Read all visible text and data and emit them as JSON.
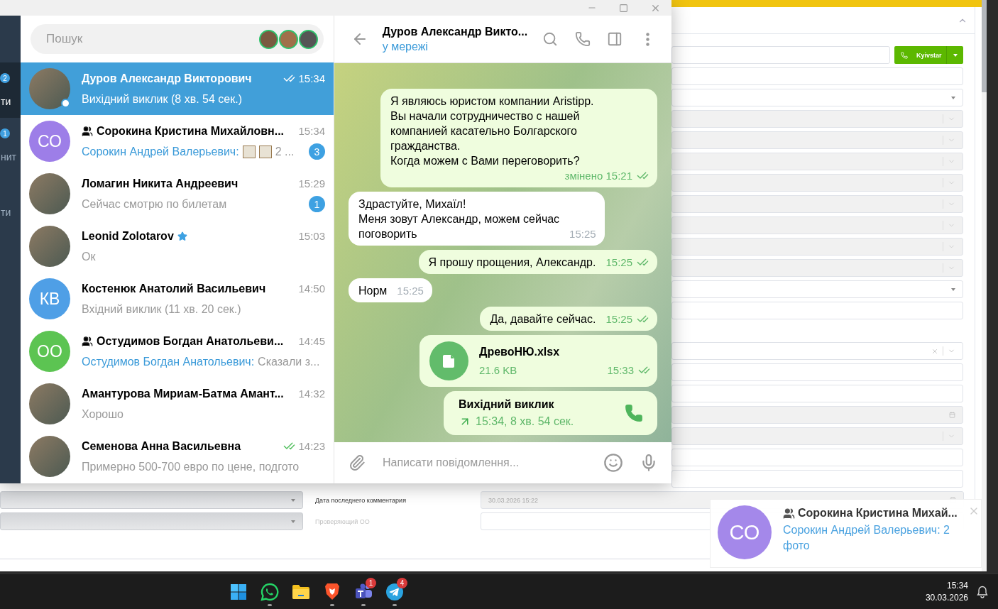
{
  "crm": {
    "call_button": "Kyivstar",
    "sections": [
      [
        {
          "kind": "call"
        },
        {
          "kind": "input"
        },
        {
          "kind": "select"
        },
        {
          "kind": "locked"
        },
        {
          "kind": "locked"
        },
        {
          "kind": "locked"
        },
        {
          "kind": "locked"
        },
        {
          "kind": "locked"
        },
        {
          "kind": "locked"
        },
        {
          "kind": "locked"
        },
        {
          "kind": "locked"
        },
        {
          "kind": "select"
        },
        {
          "kind": "input"
        }
      ],
      [
        {
          "kind": "clearable"
        },
        {
          "kind": "input"
        },
        {
          "kind": "input"
        },
        {
          "kind": "date"
        },
        {
          "kind": "locked"
        },
        {
          "kind": "input"
        },
        {
          "kind": "input"
        },
        {
          "kind": "date",
          "label": "Дата последнего комментария",
          "value": "30.03.2026 15:22"
        },
        {
          "kind": "input",
          "label": "Проверяющий ОО"
        }
      ]
    ]
  },
  "telegram": {
    "folders": [
      {
        "label": "ти",
        "badge": "2",
        "selected": true
      },
      {
        "label": "нит",
        "badge": "1",
        "selected": false
      },
      {
        "label": "ти",
        "selected": false
      }
    ],
    "search": {
      "placeholder": "Пошук"
    },
    "chats": [
      {
        "name": "Дуров Александр Викторович",
        "time": "15:34",
        "preview": "Вихідний виклик (8 хв. 54 сек.)",
        "group": false,
        "avatar": {
          "kind": "photo"
        },
        "selected": true,
        "online": true,
        "read": true,
        "starred": false
      },
      {
        "name": "Сорокина Кристина Михайловн...",
        "time": "15:34",
        "sender": "Сорокин Андрей Валерьевич:",
        "attachments": [
          {
            "kind": "photo"
          },
          {
            "kind": "photo"
          }
        ],
        "preview": "2 ...",
        "group": true,
        "avatar": {
          "kind": "initials",
          "initials": "СО",
          "color": "#9d7ee8"
        },
        "selected": false,
        "online": false,
        "read": false,
        "starred": false,
        "unread": "3"
      },
      {
        "name": "Ломагин Никита Андреевич",
        "time": "15:29",
        "preview": "Сейчас смотрю по билетам",
        "group": false,
        "avatar": {
          "kind": "photo"
        },
        "selected": false,
        "online": false,
        "read": false,
        "starred": false,
        "unread": "1"
      },
      {
        "name": "Leonid Zolotarov",
        "time": "15:03",
        "preview": "Ок",
        "group": false,
        "avatar": {
          "kind": "photo"
        },
        "selected": false,
        "online": false,
        "read": false,
        "starred": true
      },
      {
        "name": "Костенюк Анатолий Васильевич",
        "time": "14:50",
        "preview": "Вхідний виклик (11 хв. 20 сек.)",
        "group": false,
        "avatar": {
          "kind": "initials",
          "initials": "КВ",
          "color": "#4f9fe6"
        },
        "selected": false,
        "online": false,
        "read": false,
        "starred": false
      },
      {
        "name": "Остудимов Богдан Анатольеви...",
        "time": "14:45",
        "sender": "Остудимов Богдан Анатольевич:",
        "preview": "Сказали з...",
        "group": true,
        "avatar": {
          "kind": "initials",
          "initials": "ОО",
          "color": "#5cc452"
        },
        "selected": false,
        "online": false,
        "read": false,
        "starred": false
      },
      {
        "name": "Амантурова Мириам-Батма Амант...",
        "time": "14:32",
        "preview": "Хорошо",
        "group": false,
        "avatar": {
          "kind": "photo"
        },
        "selected": false,
        "online": false,
        "read": false,
        "starred": false
      },
      {
        "name": "Семенова Анна Васильевна",
        "time": "14:23",
        "preview": "Примерно 500-700 евро по цене, подгото",
        "group": false,
        "avatar": {
          "kind": "photo"
        },
        "selected": false,
        "online": false,
        "read": true,
        "starred": false
      }
    ],
    "chat": {
      "title": "Дуров Александр Викто...",
      "status": "у мережі",
      "messages": [
        {
          "kind": "text",
          "outgoing": true,
          "text": "Я являюсь юристом компании Aristipp.\nВы начали сотрудничество с нашей\nкомпанией касательно Болгарского\nгражданства.\nКогда можем с Вами переговорить?",
          "time": "змінено 15:21",
          "read": true
        },
        {
          "kind": "text",
          "outgoing": false,
          "text": "Здрастуйте, Михаїл!\nМеня зовут Александр, можем сейчас\nпоговорить",
          "time": "15:25",
          "read": false
        },
        {
          "kind": "text",
          "outgoing": true,
          "text": "Я прошу прощения, Александр.",
          "time": "15:25",
          "read": true
        },
        {
          "kind": "text",
          "outgoing": false,
          "text": "Норм",
          "time": "15:25",
          "read": false
        },
        {
          "kind": "text",
          "outgoing": true,
          "text": "Да, давайте сейчас.",
          "time": "15:25",
          "read": true
        },
        {
          "kind": "file",
          "outgoing": true,
          "name": "ДревоНЮ.xlsx",
          "size": "21.6 KB",
          "time": "15:33",
          "read": true
        },
        {
          "kind": "call",
          "outgoing": true,
          "title": "Вихідний виклик",
          "detail": "15:34, 8 хв. 54 сек."
        }
      ],
      "composer": {
        "placeholder": "Написати повідомлення..."
      }
    }
  },
  "notification": {
    "title": "Сорокина Кристина Михай...",
    "group": true,
    "preview": "Сорокин Андрей Валерьевич: 2 фото",
    "avatar": {
      "initials": "СО",
      "color": "#a488ea"
    }
  },
  "taskbar": {
    "apps": [
      {
        "kind": "start",
        "running": false
      },
      {
        "kind": "whatsapp",
        "running": true
      },
      {
        "kind": "explorer",
        "running": false
      },
      {
        "kind": "brave",
        "running": true
      },
      {
        "kind": "teams",
        "running": true,
        "badge": "1"
      },
      {
        "kind": "telegram",
        "running": true,
        "badge": "4"
      }
    ],
    "time": "15:34",
    "date": "30.03.2026"
  }
}
